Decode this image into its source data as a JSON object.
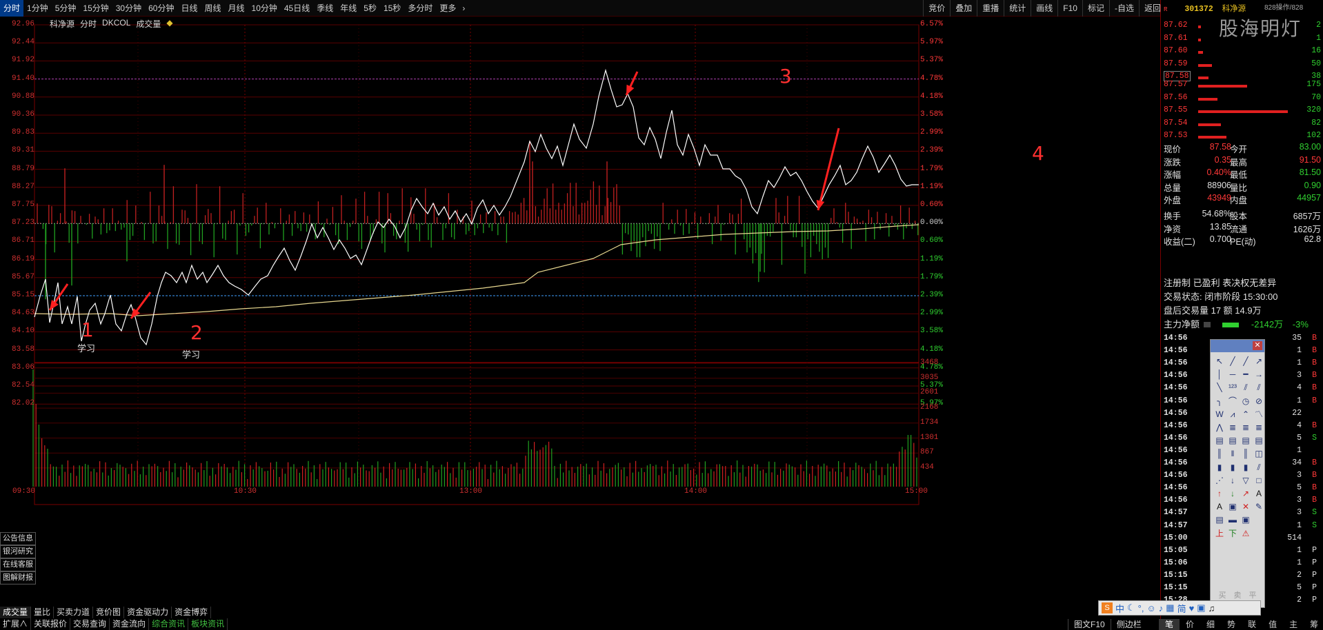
{
  "toolbar": {
    "timeframes": [
      "分时",
      "1分钟",
      "5分钟",
      "15分钟",
      "30分钟",
      "60分钟",
      "日线",
      "周线",
      "月线",
      "10分钟",
      "45日线",
      "季线",
      "年线",
      "5秒",
      "15秒",
      "多分时",
      "更多"
    ],
    "right_buttons": [
      "竞价",
      "叠加",
      "重播",
      "统计",
      "画线",
      "F10",
      "标记",
      "-自选",
      "返回"
    ]
  },
  "chart_header": {
    "stock_name": "科净源",
    "mode": "分时",
    "indicator": "DKCOL",
    "volume_label": "成交量",
    "star": "◆"
  },
  "price_axis": [
    "92.96",
    "92.44",
    "91.92",
    "91.40",
    "90.88",
    "90.36",
    "89.83",
    "89.31",
    "88.79",
    "88.27",
    "87.75",
    "87.23",
    "86.71",
    "86.19",
    "85.67",
    "85.15",
    "84.63",
    "84.10",
    "83.58",
    "83.06",
    "82.54",
    "82.02"
  ],
  "pct_axis": [
    "6.57%",
    "5.97%",
    "5.37%",
    "4.78%",
    "4.18%",
    "3.58%",
    "2.99%",
    "2.39%",
    "1.79%",
    "1.19%",
    "0.60%",
    "0.00%",
    "0.60%",
    "1.19%",
    "1.79%",
    "2.39%",
    "2.99%",
    "3.58%",
    "4.18%",
    "4.78%",
    "5.37%",
    "5.97%"
  ],
  "volume_axis": [
    "3468",
    "3035",
    "2601",
    "2168",
    "1734",
    "1301",
    "867",
    "434"
  ],
  "time_axis": [
    "09:30",
    "10:30",
    "13:00",
    "14:00",
    "15:00"
  ],
  "annotations": [
    {
      "num": "1",
      "text": "学习"
    },
    {
      "num": "2",
      "text": "学习"
    },
    {
      "num": "3",
      "text": ""
    },
    {
      "num": "4",
      "text": ""
    }
  ],
  "side_tabs": [
    "公告信息",
    "银河研究",
    "在线客服",
    "图解财报"
  ],
  "bottom_tabs_1": [
    "成交量",
    "量比",
    "买卖力道",
    "竞价图",
    "资金驱动力",
    "资金博弈"
  ],
  "bottom_tabs_2": [
    "扩展∧",
    "关联报价",
    "交易查询",
    "资金流向",
    "综合资讯",
    "板块资讯"
  ],
  "right_panel": {
    "code": "301372",
    "name": "科净源",
    "corner": "R",
    "watermark": "股海明灯",
    "top_note": "828操作/828",
    "order_book_sell": [
      {
        "price": "87.62",
        "vol": "2"
      },
      {
        "price": "87.61",
        "vol": "1"
      },
      {
        "price": "87.60",
        "vol": "16"
      },
      {
        "price": "87.59",
        "vol": "50"
      },
      {
        "price": "87.58",
        "vol": "38"
      }
    ],
    "order_book_buy": [
      {
        "price": "87.57",
        "vol": "175"
      },
      {
        "price": "87.56",
        "vol": "70"
      },
      {
        "price": "87.55",
        "vol": "320"
      },
      {
        "price": "87.54",
        "vol": "82"
      },
      {
        "price": "87.53",
        "vol": "102"
      }
    ],
    "stats": [
      {
        "l1": "现价",
        "v1": "87.58",
        "l2": "今开",
        "v2": "83.00"
      },
      {
        "l1": "涨跌",
        "v1": "0.35",
        "l2": "最高",
        "v2": "91.50"
      },
      {
        "l1": "涨幅",
        "v1": "0.40%",
        "l2": "最低",
        "v2": "81.50"
      },
      {
        "l1": "总量",
        "v1": "88906",
        "l2": "量比",
        "v2": "0.90"
      },
      {
        "l1": "外盘",
        "v1": "43949",
        "l2": "内盘",
        "v2": "44957"
      }
    ],
    "stats2": [
      {
        "l1": "换手",
        "v1": "54.68%",
        "l2": "股本",
        "v2": "6857万"
      },
      {
        "l1": "净资",
        "v1": "13.85",
        "l2": "流通",
        "v2": "1626万"
      },
      {
        "l1": "收益(二)",
        "v1": "0.700",
        "l2": "PE(动)",
        "v2": "62.8"
      }
    ],
    "reg_line": "注册制 已盈利 表决权无差异",
    "trade_status": "交易状态: 闭市阶段 15:30:00",
    "after_hours": "盘后交易量 17 额 14.9万",
    "main_net_label": "主力净额",
    "main_net_value": "-2142万",
    "main_net_pct": "-3%",
    "ticks": [
      {
        "time": "14:56",
        "vol": "35",
        "side": "B"
      },
      {
        "time": "14:56",
        "vol": "1",
        "side": "B"
      },
      {
        "time": "14:56",
        "vol": "1",
        "side": "B"
      },
      {
        "time": "14:56",
        "vol": "3",
        "side": "B"
      },
      {
        "time": "14:56",
        "vol": "4",
        "side": "B"
      },
      {
        "time": "14:56",
        "vol": "1",
        "side": "B"
      },
      {
        "time": "14:56",
        "vol": "22",
        "side": ""
      },
      {
        "time": "14:56",
        "vol": "4",
        "side": "B"
      },
      {
        "time": "14:56",
        "vol": "5",
        "side": "S"
      },
      {
        "time": "14:56",
        "vol": "1",
        "side": ""
      },
      {
        "time": "14:56",
        "vol": "34",
        "side": "B"
      },
      {
        "time": "14:56",
        "vol": "3",
        "side": "B"
      },
      {
        "time": "14:56",
        "vol": "5",
        "side": "B"
      },
      {
        "time": "14:56",
        "vol": "3",
        "side": "B"
      },
      {
        "time": "14:57",
        "vol": "3",
        "side": "S"
      },
      {
        "time": "14:57",
        "vol": "1",
        "side": "S"
      },
      {
        "time": "15:00",
        "vol": "514",
        "side": ""
      },
      {
        "time": "15:05",
        "vol": "1",
        "side": "P"
      },
      {
        "time": "15:06",
        "vol": "1",
        "side": "P"
      },
      {
        "time": "15:15",
        "vol": "2",
        "side": "P"
      },
      {
        "time": "15:15",
        "vol": "5",
        "side": "P"
      },
      {
        "time": "15:28",
        "vol": "2",
        "side": "P"
      }
    ]
  },
  "toolbox": {
    "bottom_labels": [
      "买",
      "卖",
      "平"
    ],
    "letter_tools": [
      "A",
      "'A",
      "上",
      "下"
    ]
  },
  "tray": {
    "items": [
      "中",
      "简"
    ]
  },
  "statusbar": [
    "图文F10",
    "侧边栏"
  ],
  "statusbar_right": [
    "笔",
    "价",
    "细",
    "势",
    "联",
    "值",
    "主",
    "筹"
  ],
  "colors": {
    "up": "#ff3838",
    "down": "#30d030",
    "price_line": "#ffffff",
    "avg_line": "#e8d890",
    "grid": "#7a0000"
  }
}
